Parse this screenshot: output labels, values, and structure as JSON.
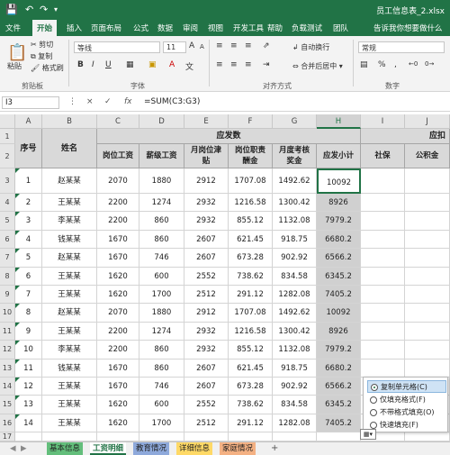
{
  "titlebar": {
    "title": "员工信息表_2.xlsx",
    "save_icon": "save-icon",
    "undo_icon": "undo-icon",
    "redo_icon": "redo-icon",
    "customize_icon": "chevron-down-icon"
  },
  "ribbon_tabs": [
    "文件",
    "开始",
    "插入",
    "页面布局",
    "公式",
    "数据",
    "审阅",
    "视图",
    "开发工具",
    "帮助",
    "负载测试",
    "团队"
  ],
  "active_tab": "开始",
  "tell_me": "告诉我你想要做什么",
  "clipboard": {
    "paste": "粘贴",
    "cut": "剪切",
    "copy": "复制",
    "format_painter": "格式刷",
    "group": "剪贴板"
  },
  "font": {
    "name": "等线",
    "size": "11",
    "bold": "B",
    "italic": "I",
    "underline": "U",
    "grow": "A",
    "shrink": "A",
    "group": "字体"
  },
  "alignment": {
    "wrap": "自动换行",
    "merge": "合并后居中",
    "group": "对齐方式"
  },
  "number": {
    "format": "常规",
    "percent": "%",
    "comma": ",",
    "group": "数字"
  },
  "formula_bar": {
    "name_box": "I3",
    "cancel": "×",
    "enter": "✓",
    "fx": "fx",
    "formula": "=SUM(C3:G3)"
  },
  "columns": [
    "A",
    "B",
    "C",
    "D",
    "E",
    "F",
    "G",
    "H",
    "I",
    "J"
  ],
  "selected_column": "H",
  "rows": [
    "1",
    "2",
    "3",
    "4",
    "5",
    "6",
    "7",
    "8",
    "9",
    "10",
    "11",
    "12",
    "13",
    "14",
    "15",
    "16",
    "17"
  ],
  "table": {
    "header_group": "应发数",
    "header_group_right": "应扣",
    "h_index": "序号",
    "h_name": "姓名",
    "h_base": "岗位工资",
    "h_level": "薪级工资",
    "h_allow": "月岗位津贴",
    "h_resp": "岗位职责酬金",
    "h_bonus": "月度考核奖金",
    "h_total": "应发小计",
    "h_social": "社保",
    "h_fund": "公积金",
    "data": [
      [
        "1",
        "赵某某",
        "2070",
        "1880",
        "2912",
        "1707.08",
        "1492.62",
        "10092"
      ],
      [
        "2",
        "王某某",
        "2200",
        "1274",
        "2932",
        "1216.58",
        "1300.42",
        "8926"
      ],
      [
        "3",
        "李某某",
        "2200",
        "860",
        "2932",
        "855.12",
        "1132.08",
        "7979.2"
      ],
      [
        "4",
        "钱某某",
        "1670",
        "860",
        "2607",
        "621.45",
        "918.75",
        "6680.2"
      ],
      [
        "5",
        "赵某某",
        "1670",
        "746",
        "2607",
        "673.28",
        "902.92",
        "6566.2"
      ],
      [
        "6",
        "王某某",
        "1620",
        "600",
        "2552",
        "738.62",
        "834.58",
        "6345.2"
      ],
      [
        "7",
        "王某某",
        "1620",
        "1700",
        "2512",
        "291.12",
        "1282.08",
        "7405.2"
      ],
      [
        "8",
        "赵某某",
        "2070",
        "1880",
        "2912",
        "1707.08",
        "1492.62",
        "10092"
      ],
      [
        "9",
        "王某某",
        "2200",
        "1274",
        "2932",
        "1216.58",
        "1300.42",
        "8926"
      ],
      [
        "10",
        "李某某",
        "2200",
        "860",
        "2932",
        "855.12",
        "1132.08",
        "7979.2"
      ],
      [
        "11",
        "钱某某",
        "1670",
        "860",
        "2607",
        "621.45",
        "918.75",
        "6680.2"
      ],
      [
        "12",
        "王某某",
        "1670",
        "746",
        "2607",
        "673.28",
        "902.92",
        "6566.2"
      ],
      [
        "13",
        "王某某",
        "1620",
        "600",
        "2552",
        "738.62",
        "834.58",
        "6345.2"
      ],
      [
        "14",
        "王某某",
        "1620",
        "1700",
        "2512",
        "291.12",
        "1282.08",
        "7405.2"
      ]
    ]
  },
  "autofill_menu": {
    "items": [
      "复制单元格(C)",
      "仅填充格式(F)",
      "不带格式填充(O)",
      "快速填充(F)"
    ],
    "selected": 0,
    "button_icon": "autofill-options-icon"
  },
  "sheets": [
    "基本信息",
    "工资明细",
    "教育情况",
    "详细信息",
    "家庭情况"
  ],
  "active_sheet": "工资明细",
  "add_sheet": "+",
  "colors": {
    "accent": "#217346",
    "tab_green": "#63be7b",
    "tab_blue": "#8ea9db",
    "tab_yellow": "#ffd966",
    "tab_orange": "#f4b183"
  }
}
